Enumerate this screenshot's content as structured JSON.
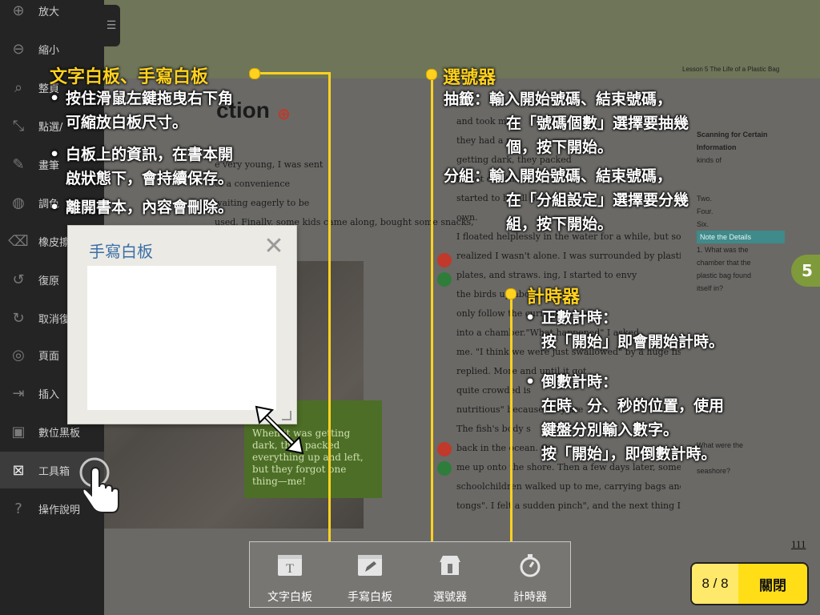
{
  "sidebar": {
    "items": [
      {
        "label": "放大",
        "icon": "zoom-in-icon"
      },
      {
        "label": "縮小",
        "icon": "zoom-out-icon"
      },
      {
        "label": "整頁",
        "icon": "fit-page-icon"
      },
      {
        "label": "點選/",
        "icon": "pointer-icon"
      },
      {
        "label": "畫筆",
        "icon": "pen-icon"
      },
      {
        "label": "調色",
        "icon": "palette-icon"
      },
      {
        "label": "橡皮擦",
        "icon": "eraser-icon"
      },
      {
        "label": "復原",
        "icon": "undo-icon"
      },
      {
        "label": "取消復",
        "icon": "redo-icon"
      },
      {
        "label": "頁面",
        "icon": "page-icon"
      },
      {
        "label": "插入",
        "icon": "insert-icon"
      },
      {
        "label": "數位黑板",
        "icon": "blackboard-icon"
      },
      {
        "label": "工具箱",
        "icon": "toolbox-icon"
      },
      {
        "label": "操作說明",
        "icon": "help-icon"
      }
    ]
  },
  "book": {
    "lesson_header": "Lesson 5 The Life of a Plastic Bag",
    "heading": "ction",
    "page_number": "111",
    "lesson_badge": "5",
    "lines": [
      "and took me",
      "they had a p",
      "getting dark, they packed",
      "forgot one thi",
      "started to ha        all on my",
      "own.",
      "I floated helplessly in the water for a while, but soon",
      "realized I wasn't alone. I was surrounded by plastic cups,",
      "plates, and straws.   ing, I started to envy",
      "the birds up above,         I could",
      "only follow the current           own a",
      "into a chamber.\"What happened\" I asked",
      "me. \"I think we were just swallowed\" by a huge fish!\" he",
      "replied. More and          until it got",
      "quite crowded        is",
      "nutritious\" because they are",
      "The fish's body s",
      "back in the ocean. O",
      "me up onto the shore. Then a few days later, some",
      "schoolchildren walked up to me, carrying bags and pairs of",
      "tongs\". I felt a sudden pinch\", and the next thing I knew, I"
    ],
    "left_lines": [
      "e very young, I was sent",
      "to a convenience",
      "waiting eagerly to be",
      "used. Finally, some kids came along, bought some snacks,"
    ],
    "side_panel": [
      "Scanning for Certain",
      "Information",
      "kinds of",
      "Two.",
      "Four.",
      "Six.",
      "Note the Details",
      "1. What was the",
      "chamber that the",
      "plastic bag found",
      "itself in?",
      "What were the",
      "seashore?"
    ],
    "quote": "When it was getting dark, they packed everything up and left, but they forgot one thing—me!"
  },
  "whiteboard": {
    "title": "手寫白板",
    "close_glyph": "✕"
  },
  "annotations": {
    "whiteboard": {
      "title": "文字白板、手寫白板",
      "lines": [
        "按住滑鼠左鍵拖曳右下角",
        "可縮放白板尺寸。",
        "白板上的資訊，在書本開",
        "啟狀態下，會持續保存。",
        "離開書本，內容會刪除。"
      ]
    },
    "picker": {
      "title": "選號器",
      "lines": [
        "抽籤：輸入開始號碼、結束號碼，",
        "在「號碼個數」選擇要抽幾",
        "個，按下開始。",
        "分組：輸入開始號碼、結束號碼，",
        "在「分組設定」選擇要分幾",
        "組，按下開始。"
      ]
    },
    "timer": {
      "title": "計時器",
      "lines": [
        "正數計時：",
        "按「開始」即會開始計時。",
        "倒數計時：",
        "在時、分、秒的位置，使用",
        "鍵盤分別輸入數字。",
        "按「開始」，即倒數計時。"
      ]
    }
  },
  "toolbar": {
    "tools": [
      {
        "label": "文字白板",
        "icon": "text-whiteboard-icon"
      },
      {
        "label": "手寫白板",
        "icon": "handwriting-whiteboard-icon"
      },
      {
        "label": "選號器",
        "icon": "number-picker-icon"
      },
      {
        "label": "計時器",
        "icon": "timer-icon"
      }
    ]
  },
  "pager": {
    "count": "8 / 8",
    "close_label": "關閉"
  },
  "colors": {
    "annotation_accent": "#ffd21f",
    "pager_bg": "#ffde17",
    "whiteboard_title": "#3a6fa8"
  }
}
